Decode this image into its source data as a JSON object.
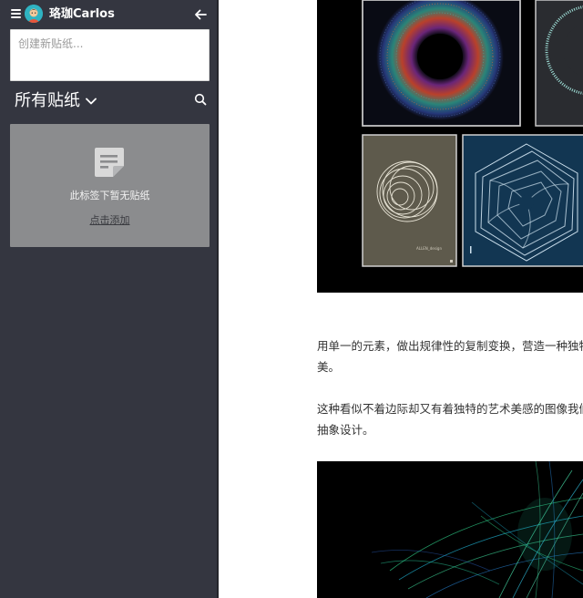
{
  "sidebar": {
    "username": "珞珈Carlos",
    "new_note_placeholder": "创建新贴纸...",
    "filter_title": "所有贴纸",
    "empty_message": "此标签下暂无贴纸",
    "add_link": "点击添加"
  },
  "article": {
    "paragraph_1_line_1": "用单一的元素，做出规律性的复制变换，营造一种独特",
    "paragraph_1_line_2": "美。",
    "paragraph_2_line_1": "这种看似不着边际却又有着独特的艺术美感的图像我们",
    "paragraph_2_line_2": "抽象设计。",
    "poster_caption": "ALLEN_design"
  },
  "colors": {
    "sidebar_bg": "#343640",
    "card_bg": "#8b8c8e",
    "poster_navy": "#123652",
    "poster_khaki": "#5e5a4c"
  }
}
